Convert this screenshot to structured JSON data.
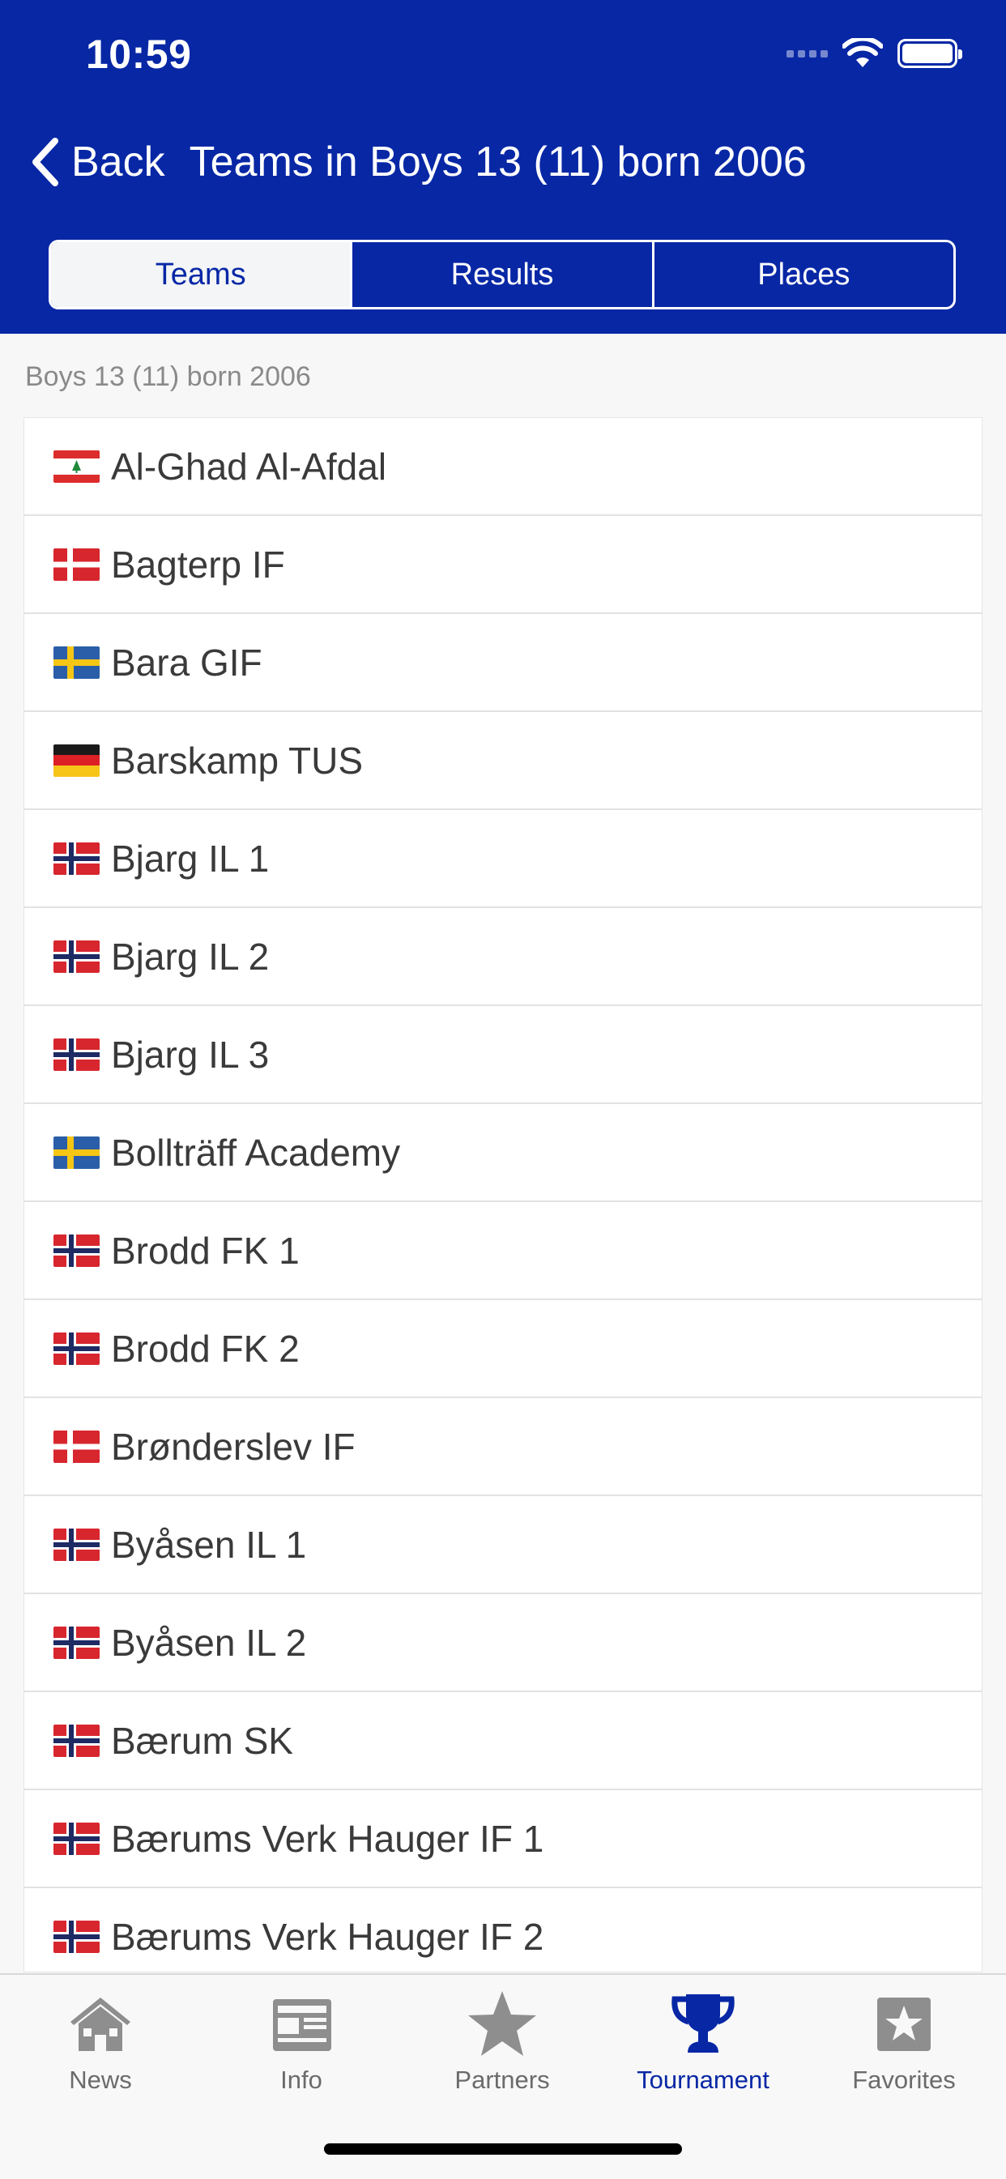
{
  "status": {
    "time": "10:59"
  },
  "nav": {
    "back_label": "Back",
    "title": "Teams in Boys 13 (11) born 2006"
  },
  "segments": [
    {
      "label": "Teams",
      "active": true
    },
    {
      "label": "Results",
      "active": false
    },
    {
      "label": "Places",
      "active": false
    }
  ],
  "section": {
    "label": "Boys 13 (11) born 2006"
  },
  "teams": [
    {
      "name": "Al-Ghad Al-Afdal",
      "flag": "lebanon-flag-icon"
    },
    {
      "name": "Bagterp IF",
      "flag": "denmark-flag-icon"
    },
    {
      "name": "Bara GIF",
      "flag": "sweden-flag-icon"
    },
    {
      "name": "Barskamp TUS",
      "flag": "germany-flag-icon"
    },
    {
      "name": "Bjarg IL 1",
      "flag": "norway-flag-icon"
    },
    {
      "name": "Bjarg IL 2",
      "flag": "norway-flag-icon"
    },
    {
      "name": "Bjarg IL 3",
      "flag": "norway-flag-icon"
    },
    {
      "name": "Bollträff Academy",
      "flag": "sweden-flag-icon"
    },
    {
      "name": "Brodd FK 1",
      "flag": "norway-flag-icon"
    },
    {
      "name": "Brodd FK 2",
      "flag": "norway-flag-icon"
    },
    {
      "name": "Brønderslev IF",
      "flag": "denmark-flag-icon"
    },
    {
      "name": "Byåsen IL 1",
      "flag": "norway-flag-icon"
    },
    {
      "name": "Byåsen IL 2",
      "flag": "norway-flag-icon"
    },
    {
      "name": "Bærum SK",
      "flag": "norway-flag-icon"
    },
    {
      "name": "Bærums Verk Hauger IF 1",
      "flag": "norway-flag-icon"
    },
    {
      "name": "Bærums Verk Hauger IF 2",
      "flag": "norway-flag-icon"
    }
  ],
  "tabbar": [
    {
      "label": "News",
      "icon": "house-icon",
      "active": false
    },
    {
      "label": "Info",
      "icon": "newspaper-icon",
      "active": false
    },
    {
      "label": "Partners",
      "icon": "star-icon",
      "active": false
    },
    {
      "label": "Tournament",
      "icon": "trophy-icon",
      "active": true
    },
    {
      "label": "Favorites",
      "icon": "star-square-icon",
      "active": false
    }
  ],
  "colors": {
    "brand": "#0727a5",
    "inactive_tab": "#6b6b6b",
    "background": "#f7f7f7"
  }
}
